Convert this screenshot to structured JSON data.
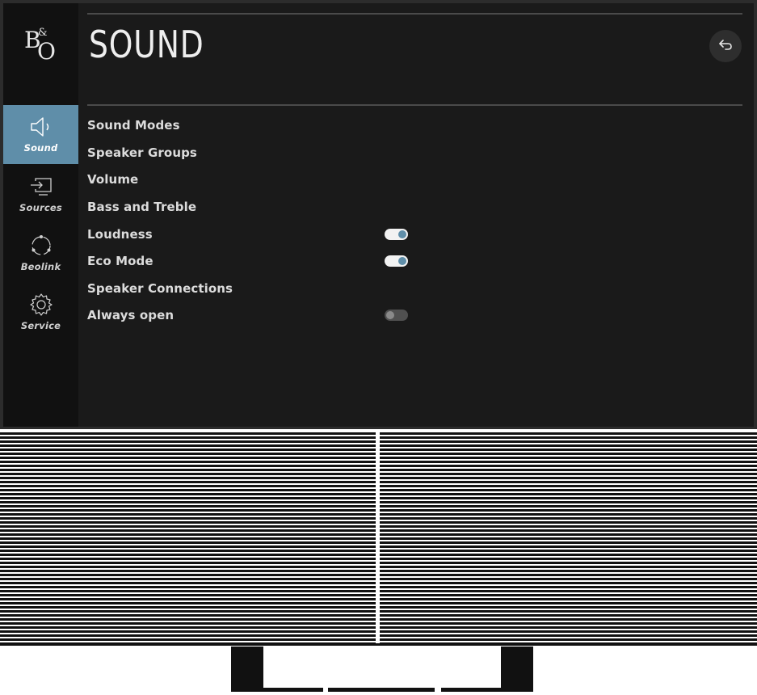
{
  "brand": {
    "logo_b": "B",
    "logo_amp": "&",
    "logo_o": "O"
  },
  "sidebar": {
    "items": [
      {
        "label": "Sound",
        "icon": "speaker-icon",
        "active": true
      },
      {
        "label": "Sources",
        "icon": "input-source-icon",
        "active": false
      },
      {
        "label": "Beolink",
        "icon": "beolink-icon",
        "active": false
      },
      {
        "label": "Service",
        "icon": "gear-icon",
        "active": false
      }
    ]
  },
  "header": {
    "title": "SOUND",
    "back_icon": "back-arrow-icon"
  },
  "menu": {
    "items": [
      {
        "label": "Sound Modes"
      },
      {
        "label": "Speaker Groups"
      },
      {
        "label": "Volume"
      },
      {
        "label": "Bass and Treble"
      },
      {
        "label": "Loudness",
        "toggle": "on"
      },
      {
        "label": "Eco Mode",
        "toggle": "on"
      },
      {
        "label": "Speaker Connections"
      },
      {
        "label": "Always open",
        "toggle": "off"
      }
    ]
  },
  "colors": {
    "accent": "#5f8ea9",
    "screen_bg": "#1a1a1a",
    "sidebar_bg": "#111111",
    "text": "#dcdcdc"
  }
}
